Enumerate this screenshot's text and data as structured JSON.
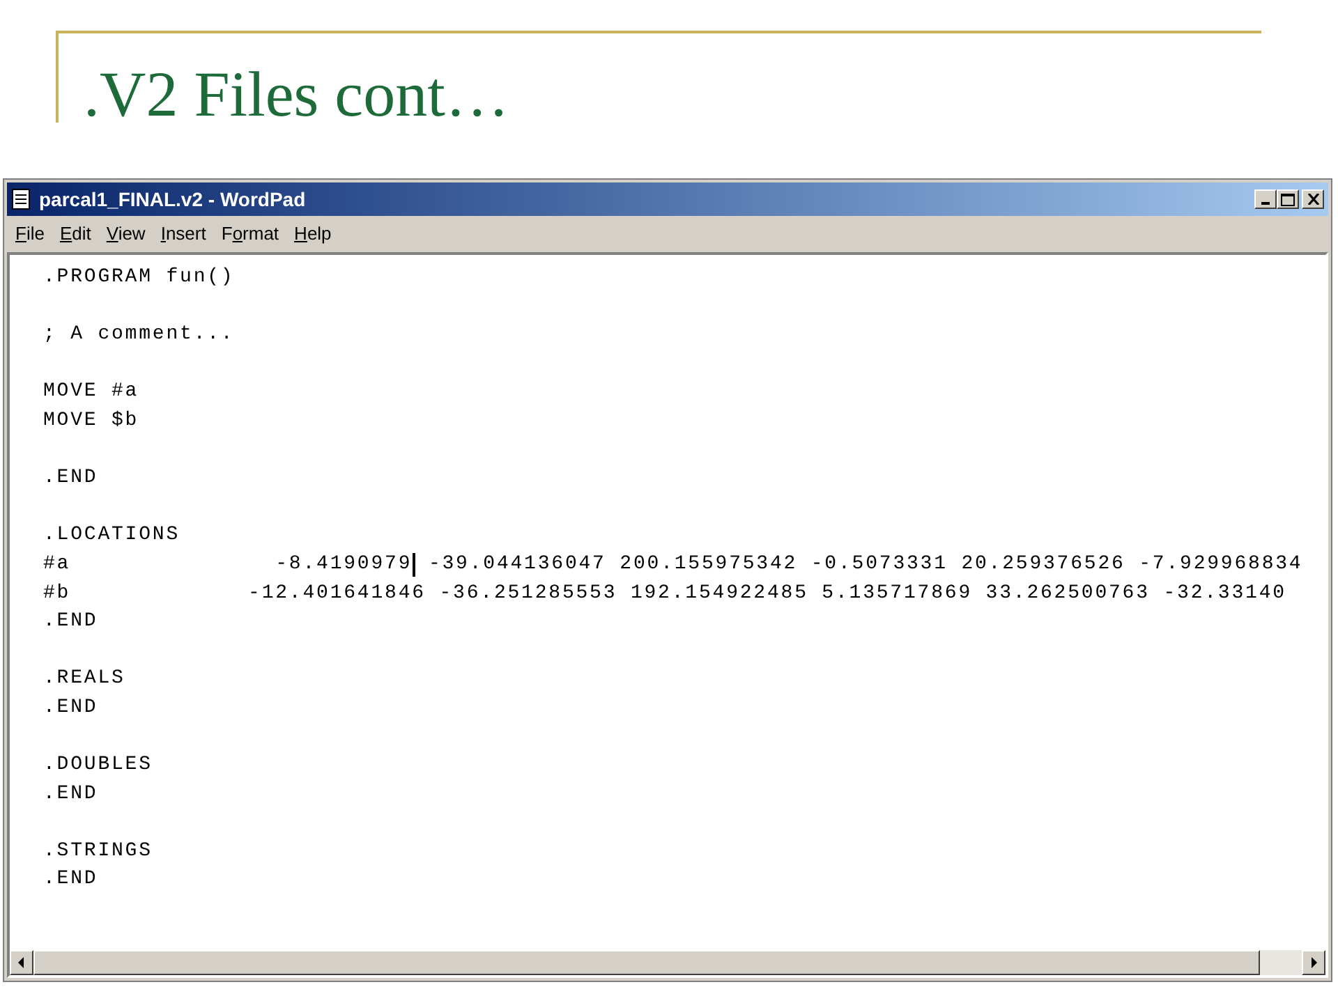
{
  "slide": {
    "title": ".V2 Files cont…"
  },
  "window": {
    "title": "parcal1_FINAL.v2 - WordPad",
    "controls": [
      {
        "kind": "minimize"
      },
      {
        "kind": "maximize"
      },
      {
        "kind": "close"
      }
    ]
  },
  "menu": [
    {
      "key": "F",
      "after": "ile"
    },
    {
      "key": "E",
      "after": "dit"
    },
    {
      "key": "V",
      "after": "iew"
    },
    {
      "key": "I",
      "after": "nsert"
    },
    {
      "before": "F",
      "key": "o",
      "after": "rmat"
    },
    {
      "key": "H",
      "after": "elp"
    }
  ],
  "document": {
    "blocks": [
      [
        {
          "text": ".PROGRAM fun()"
        }
      ],
      [
        {
          "text": "; A comment..."
        }
      ],
      [
        {
          "text": "MOVE #a"
        },
        {
          "text": "MOVE $b"
        }
      ],
      [
        {
          "text": ".END"
        }
      ],
      [
        {
          "text": ".LOCATIONS"
        },
        {
          "text": "#a               -8.4190979",
          "cursor": true,
          "text_after": " -39.044136047 200.155975342 -0.5073331 20.259376526 -7.929968834"
        },
        {
          "text": "#b             -12.401641846 -36.251285553 192.154922485 5.135717869 33.262500763 -32.33140",
          "cursor": false
        },
        {
          "text": ".END"
        }
      ],
      [
        {
          "text": ".REALS"
        },
        {
          "text": ".END"
        }
      ],
      [
        {
          "text": ".DOUBLES"
        },
        {
          "text": ".END"
        }
      ],
      [
        {
          "text": ".STRINGS"
        },
        {
          "text": ".END"
        }
      ]
    ]
  }
}
